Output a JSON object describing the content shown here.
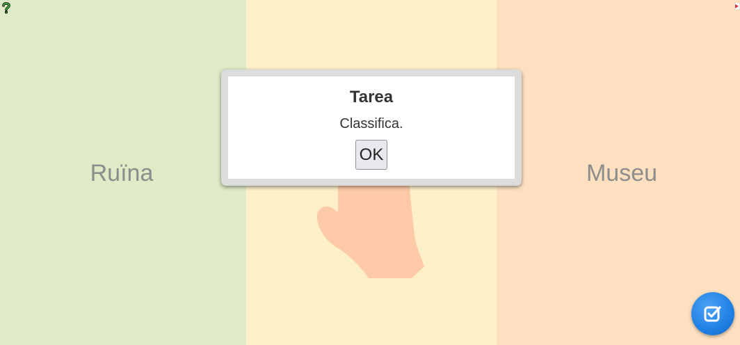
{
  "columns": {
    "left": {
      "label": "Ruïna",
      "color": "#dfeac6"
    },
    "middle": {
      "label": "",
      "color": "#fdf0c9"
    },
    "right": {
      "label": "Museu",
      "color": "#fde0c0"
    }
  },
  "dialog": {
    "title": "Tarea",
    "message": "Classifica.",
    "ok_label": "OK"
  },
  "icons": {
    "help": "help-question-icon",
    "corner": "corner-arrow-icon",
    "check": "check-square-icon",
    "hand": "hand-icon"
  },
  "colors": {
    "check_button": "#1f80e4",
    "hand": "#fdc9a6"
  }
}
